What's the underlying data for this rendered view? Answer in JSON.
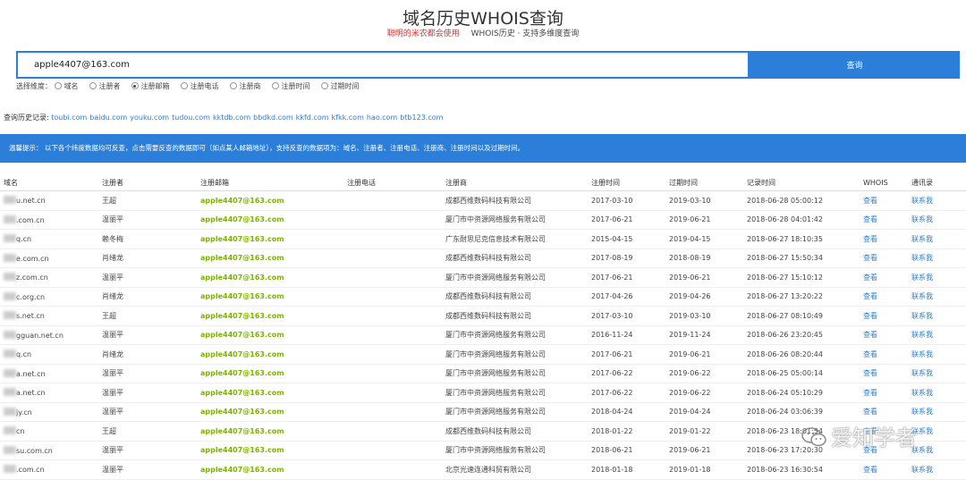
{
  "header": {
    "title": "域名历史WHOIS查询",
    "tagline_red": "聪明的米农都会使用",
    "tagline": "WHOIS历史 · 支持多维度查询"
  },
  "search": {
    "value": "apple4407@163.com",
    "button_label": "查询",
    "options_label": "选择维度：",
    "options": [
      "域名",
      "注册者",
      "注册邮箱",
      "注册电话",
      "注册商",
      "注册时间",
      "过期时间"
    ],
    "selected": "注册邮箱"
  },
  "history": {
    "label": "查询历史记录:",
    "links": [
      "toubi.com",
      "baidu.com",
      "youku.com",
      "tudou.com",
      "kktdb.com",
      "bbdkd.com",
      "kkfd.com",
      "kfkk.com",
      "hao.com",
      "btb123.com"
    ]
  },
  "banner": {
    "text": "温馨提示：  以下各个纬度数据均可反查，点击需要反查的数据即可（如点某人邮箱地址），支持反查的数据项为：域名、注册者、注册电话、注册商、注册时间以及过期时间。"
  },
  "table": {
    "headers": [
      "域名",
      "注册者",
      "注册邮箱",
      "注册电话",
      "注册商",
      "注册时间",
      "过期时间",
      "记录时间",
      "WHOIS",
      "通讯录"
    ],
    "rows": [
      {
        "domain": "u.net.cn",
        "registrant": "王超",
        "email": "apple4407@163.com",
        "phone": "",
        "registrar": "成都西维数码科技有限公司",
        "reg": "2017-03-10",
        "exp": "2019-03-10",
        "rec": "2018-06-28 05:00:12",
        "whois": "查看",
        "contact": "联系我"
      },
      {
        "domain": ".com.cn",
        "registrant": "温丽平",
        "email": "apple4407@163.com",
        "phone": "",
        "registrar": "厦门市中资源网络服务有限公司",
        "reg": "2017-06-21",
        "exp": "2019-06-21",
        "rec": "2018-06-28 04:01:42",
        "whois": "查看",
        "contact": "联系我"
      },
      {
        "domain": "q.cn",
        "registrant": "赖冬梅",
        "email": "apple4407@163.com",
        "phone": "",
        "registrar": "广东耐思尼克信息技术有限公司",
        "reg": "2015-04-15",
        "exp": "2019-04-15",
        "rec": "2018-06-27 18:10:35",
        "whois": "查看",
        "contact": "联系我"
      },
      {
        "domain": "e.com.cn",
        "registrant": "肖绪龙",
        "email": "apple4407@163.com",
        "phone": "",
        "registrar": "成都西维数码科技有限公司",
        "reg": "2017-08-19",
        "exp": "2018-08-19",
        "rec": "2018-06-27 15:50:34",
        "whois": "查看",
        "contact": "联系我"
      },
      {
        "domain": "z.com.cn",
        "registrant": "温丽平",
        "email": "apple4407@163.com",
        "phone": "",
        "registrar": "厦门市中资源网络服务有限公司",
        "reg": "2017-06-21",
        "exp": "2019-06-21",
        "rec": "2018-06-27 15:10:12",
        "whois": "查看",
        "contact": "联系我"
      },
      {
        "domain": "c.org.cn",
        "registrant": "肖绪龙",
        "email": "apple4407@163.com",
        "phone": "",
        "registrar": "成都西维数码科技有限公司",
        "reg": "2017-04-26",
        "exp": "2019-04-26",
        "rec": "2018-06-27 13:20:22",
        "whois": "查看",
        "contact": "联系我"
      },
      {
        "domain": "s.net.cn",
        "registrant": "王超",
        "email": "apple4407@163.com",
        "phone": "",
        "registrar": "成都西维数码科技有限公司",
        "reg": "2017-03-10",
        "exp": "2019-03-10",
        "rec": "2018-06-27 08:10:49",
        "whois": "查看",
        "contact": "联系我"
      },
      {
        "domain": "gguan.net.cn",
        "registrant": "温丽平",
        "email": "apple4407@163.com",
        "phone": "",
        "registrar": "厦门市中资源网络服务有限公司",
        "reg": "2016-11-24",
        "exp": "2019-11-24",
        "rec": "2018-06-26 23:20:45",
        "whois": "查看",
        "contact": "联系我"
      },
      {
        "domain": "q.cn",
        "registrant": "肖绪龙",
        "email": "apple4407@163.com",
        "phone": "",
        "registrar": "厦门市中资源网络服务有限公司",
        "reg": "2017-06-21",
        "exp": "2019-06-21",
        "rec": "2018-06-26 08:20:44",
        "whois": "查看",
        "contact": "联系我"
      },
      {
        "domain": "a.net.cn",
        "registrant": "温丽平",
        "email": "apple4407@163.com",
        "phone": "",
        "registrar": "厦门市中资源网络服务有限公司",
        "reg": "2017-06-22",
        "exp": "2019-06-22",
        "rec": "2018-06-25 05:00:14",
        "whois": "查看",
        "contact": "联系我"
      },
      {
        "domain": "a.net.cn",
        "registrant": "温丽平",
        "email": "apple4407@163.com",
        "phone": "",
        "registrar": "厦门市中资源网络服务有限公司",
        "reg": "2017-06-22",
        "exp": "2019-06-22",
        "rec": "2018-06-24 05:10:29",
        "whois": "查看",
        "contact": "联系我"
      },
      {
        "domain": "jy.cn",
        "registrant": "温丽平",
        "email": "apple4407@163.com",
        "phone": "",
        "registrar": "厦门市中资源网络服务有限公司",
        "reg": "2018-04-24",
        "exp": "2019-04-24",
        "rec": "2018-06-24 03:06:39",
        "whois": "查看",
        "contact": "联系我"
      },
      {
        "domain": "cn",
        "registrant": "王超",
        "email": "apple4407@163.com",
        "phone": "",
        "registrar": "成都西维数码科技有限公司",
        "reg": "2018-01-22",
        "exp": "2019-01-22",
        "rec": "2018-06-23 18:01:54",
        "whois": "查看",
        "contact": "联系我"
      },
      {
        "domain": "su.com.cn",
        "registrant": "温丽平",
        "email": "apple4407@163.com",
        "phone": "",
        "registrar": "厦门市中资源网络服务有限公司",
        "reg": "2018-06-21",
        "exp": "2019-06-21",
        "rec": "2018-06-23 17:20:30",
        "whois": "查看",
        "contact": "联系我"
      },
      {
        "domain": ".com.cn",
        "registrant": "温丽平",
        "email": "apple4407@163.com",
        "phone": "",
        "registrar": "北京光速连通科贸有限公司",
        "reg": "2018-01-18",
        "exp": "2019-01-18",
        "rec": "2018-06-23 16:30:54",
        "whois": "查看",
        "contact": "联系我"
      }
    ]
  },
  "watermark": {
    "text": "爱知学者"
  }
}
